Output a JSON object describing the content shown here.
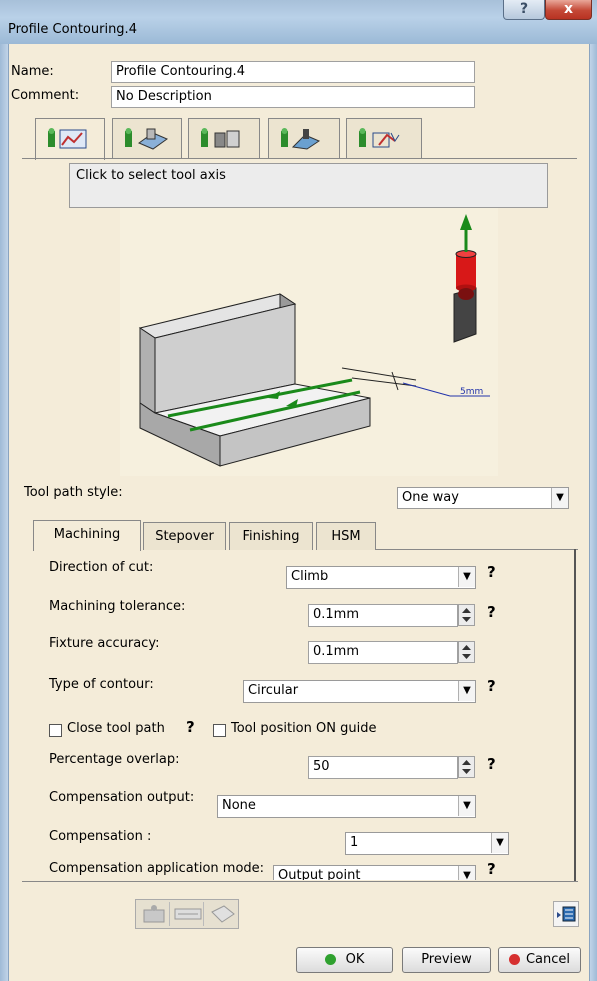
{
  "window": {
    "title": "Profile Contouring.4",
    "help_glyph": "?",
    "close_glyph": "x"
  },
  "fields": {
    "name_label": "Name:",
    "name_value": "Profile Contouring.4",
    "comment_label": "Comment:",
    "comment_value": "No Description"
  },
  "icon_tabs": [
    "strategy-tab-icon",
    "geometry-tab-icon",
    "tool-tab-icon",
    "feeds-speeds-tab-icon",
    "macro-tab-icon"
  ],
  "info_box": "Click to select tool axis",
  "diagram": {
    "dimension_label": "5mm"
  },
  "tool_path_style": {
    "label": "Tool path style:",
    "value": "One way"
  },
  "subtabs": [
    "Machining",
    "Stepover",
    "Finishing",
    "HSM"
  ],
  "machining": {
    "direction_of_cut": {
      "label": "Direction of cut:",
      "value": "Climb",
      "help": "?"
    },
    "machining_tolerance": {
      "label": "Machining tolerance:",
      "value": "0.1mm",
      "help": "?"
    },
    "fixture_accuracy": {
      "label": "Fixture accuracy:",
      "value": "0.1mm"
    },
    "type_of_contour": {
      "label": "Type of contour:",
      "value": "Circular",
      "help": "?"
    },
    "close_tool_path": {
      "label": "Close tool path",
      "help": "?"
    },
    "tool_position_on_guide": {
      "label": "Tool position ON guide"
    },
    "percentage_overlap": {
      "label": "Percentage overlap:",
      "value": "50",
      "help": "?"
    },
    "compensation_output": {
      "label": "Compensation output:",
      "value": "None"
    },
    "compensation": {
      "label": "Compensation :",
      "value": "1"
    },
    "compensation_application_mode": {
      "label": "Compensation application mode:",
      "value": "Output point",
      "help": "?"
    }
  },
  "buttons": {
    "ok": "OK",
    "preview": "Preview",
    "cancel": "Cancel"
  },
  "colors": {
    "dialog_bg": "#f4ecd9",
    "ok_dot": "#2fa12f",
    "cancel_dot": "#d63030",
    "tool_red": "#d81818",
    "path_green": "#1a8a1a"
  }
}
